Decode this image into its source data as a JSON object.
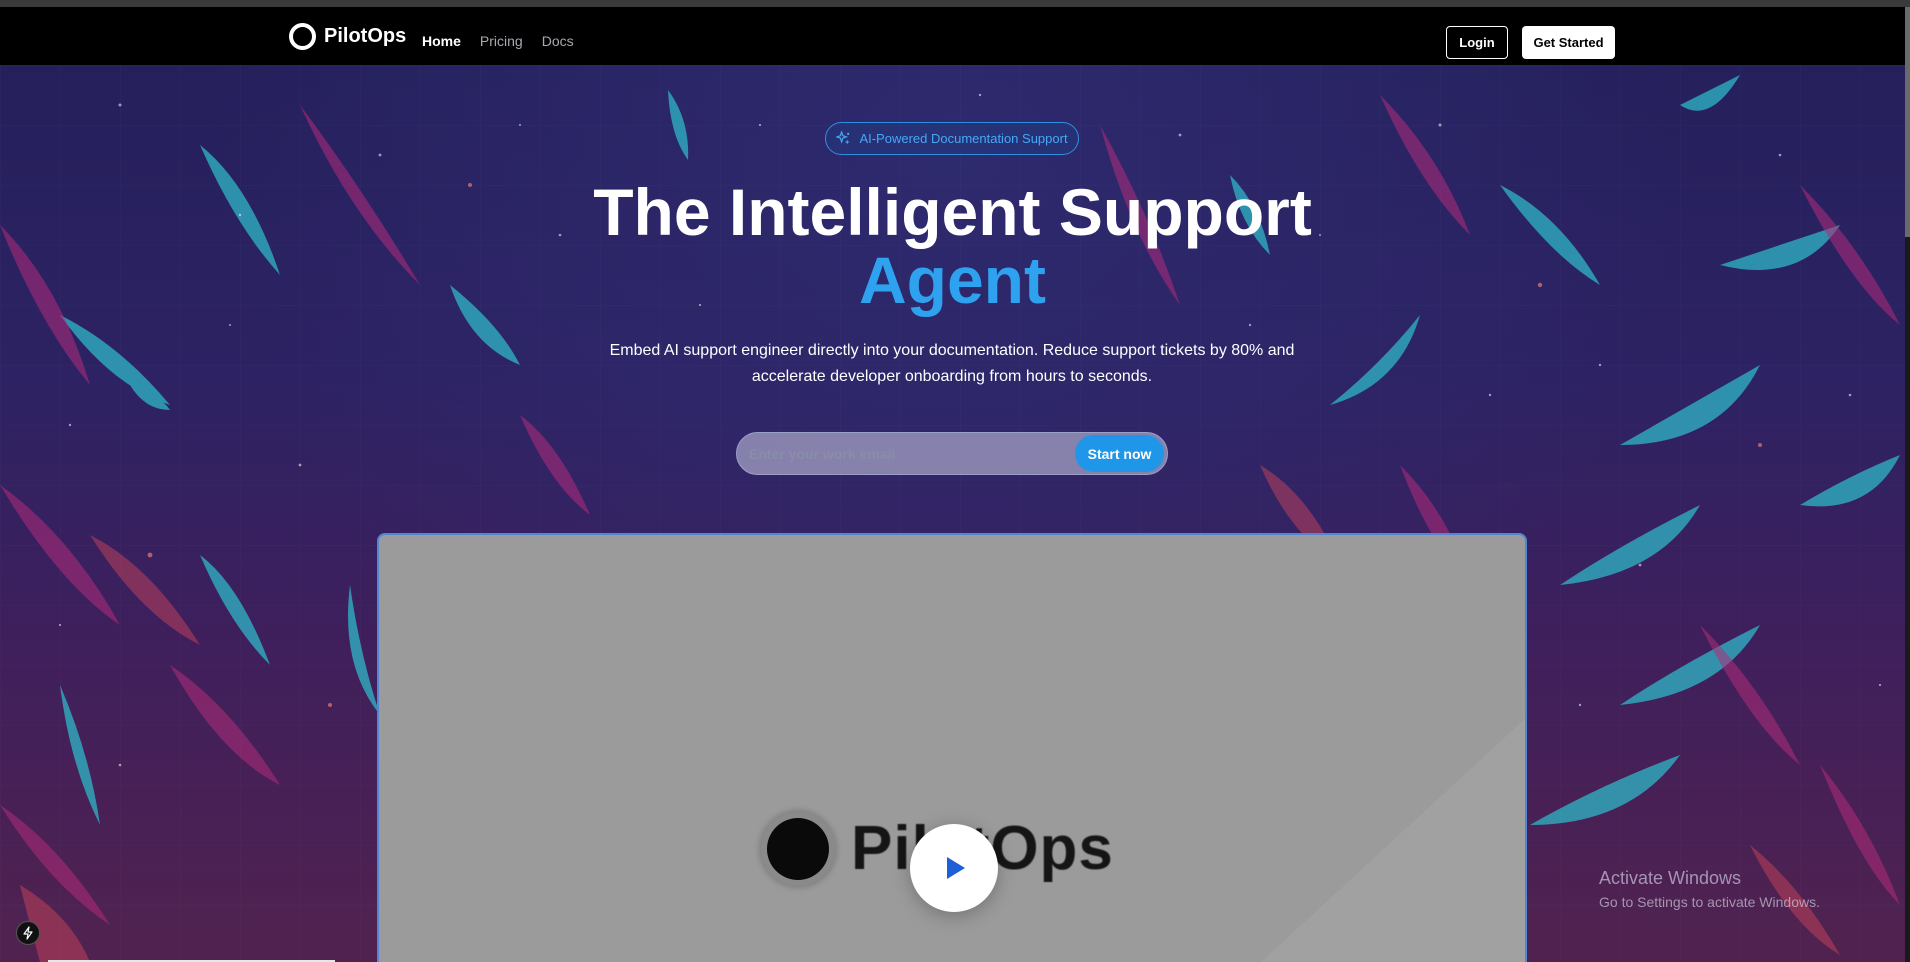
{
  "navbar": {
    "brand": "PilotOps",
    "links": [
      "Home",
      "Pricing",
      "Docs"
    ],
    "active_link": "Home",
    "login_label": "Login",
    "get_started_label": "Get Started"
  },
  "hero": {
    "badge": "AI-Powered Documentation Support",
    "headline_main": "The Intelligent Support",
    "headline_accent": "Agent",
    "subtext": "Embed AI support engineer directly into your documentation. Reduce support tickets by 80% and accelerate developer onboarding from hours to seconds.",
    "email_placeholder": "Enter your work email",
    "start_button": "Start now"
  },
  "video": {
    "brand_text": "PilotOps"
  },
  "os_watermark": {
    "title": "Activate Windows",
    "subtitle": "Go to Settings to activate Windows."
  },
  "colors": {
    "accent": "#2ea2ee",
    "button_blue": "#1f96e8",
    "navbar_bg": "#000000"
  },
  "icons": [
    "sparkles-icon",
    "play-icon",
    "lightning-icon"
  ]
}
